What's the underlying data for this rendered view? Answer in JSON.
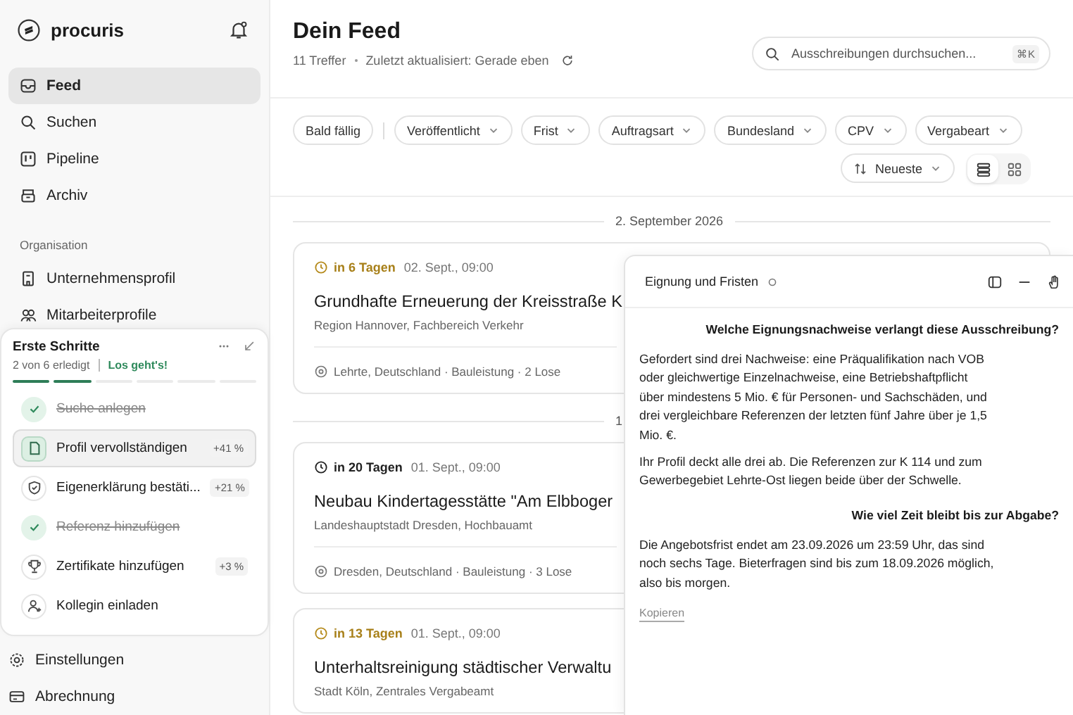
{
  "brand": {
    "name": "procuris"
  },
  "nav": [
    {
      "label": "Feed",
      "selected": true
    },
    {
      "label": "Suchen",
      "selected": false
    },
    {
      "label": "Pipeline",
      "selected": false
    },
    {
      "label": "Archiv",
      "selected": false
    }
  ],
  "org_section": {
    "title": "Organisation",
    "items": [
      {
        "label": "Unternehmensprofil",
        "selected": false
      },
      {
        "label": "Mitarbeiterprofile",
        "selected": false
      }
    ]
  },
  "onboarding": {
    "title": "Erste Schritte",
    "progress": "2 von 6 erledigt",
    "cta": "Los geht's!",
    "level": 0.333,
    "items": [
      {
        "label": "Suche anlegen",
        "done": true,
        "selected": false
      },
      {
        "label": "Profil vervollständigen",
        "gain": "+41 %",
        "done": false,
        "selected": true
      },
      {
        "label": "Eigenerklärung bestäti...",
        "gain": "+21 %",
        "done": false,
        "selected": false
      },
      {
        "label": "Referenz hinzufügen",
        "done": true,
        "selected": false
      },
      {
        "label": "Zertifikate hinzufügen",
        "gain": "+3 %",
        "done": false,
        "selected": false
      },
      {
        "label": "Kollegin einladen",
        "done": false,
        "selected": false
      }
    ]
  },
  "footer_nav": [
    {
      "label": "Einstellungen"
    },
    {
      "label": "Abrechnung"
    }
  ],
  "header": {
    "title": "Dein Feed",
    "count": "11 Treffer",
    "updated": "Zuletzt aktualisiert: Gerade eben"
  },
  "search": {
    "placeholder": "Ausschreibungen durchsuchen...",
    "shortcut": "⌘K"
  },
  "filters": [
    {
      "label": "Bald fällig",
      "kind": "toggle"
    },
    {
      "label": "Veröffentlicht",
      "kind": "dropdown"
    },
    {
      "label": "Frist",
      "kind": "dropdown"
    },
    {
      "label": "Auftragsart",
      "kind": "dropdown"
    },
    {
      "label": "Bundesland",
      "kind": "dropdown"
    },
    {
      "label": "CPV",
      "kind": "dropdown"
    },
    {
      "label": "Vergabeart",
      "kind": "dropdown"
    }
  ],
  "sort": {
    "label": "Neueste"
  },
  "views": [
    {
      "kind": "list",
      "selected": true
    },
    {
      "kind": "grid",
      "selected": false
    }
  ],
  "feed": [
    {
      "date": "2. September 2026",
      "cards": [
        {
          "deadline": "in 6 Tagen",
          "urgent": true,
          "time": "02. Sept., 09:00",
          "title": "Grundhafte Erneuerung der Kreisstraße K",
          "org": "Region Hannover, Fachbereich Verkehr",
          "meta": "Lehrte, Deutschland · Bauleistung · 2 Lose"
        }
      ]
    },
    {
      "date": "1",
      "cards": [
        {
          "deadline": "in 20 Tagen",
          "urgent": false,
          "time": "01. Sept., 09:00",
          "title": "Neubau Kindertagesstätte \"Am Elbboger",
          "org": "Landeshauptstadt Dresden, Hochbauamt",
          "meta": "Dresden, Deutschland · Bauleistung · 3 Lose"
        },
        {
          "deadline": "in 13 Tagen",
          "urgent": true,
          "time": "01. Sept., 09:00",
          "title": "Unterhaltsreinigung städtischer Verwaltu",
          "org": "Stadt Köln, Zentrales Vergabeamt"
        }
      ]
    }
  ],
  "chat": {
    "title": "Eignung und Fristen",
    "messages": [
      {
        "kind": "question",
        "text": "Welche Eignungsnachweise verlangt diese Ausschreibung?"
      },
      {
        "kind": "answer",
        "paragraphs": [
          "Gefordert sind drei Nachweise: eine Präqualifikation nach VOB oder gleichwertige Einzelnachweise, eine Betriebshaftpflicht über mindestens 5 Mio. € für Personen- und Sachschäden, und drei vergleichbare Referenzen der letzten fünf Jahre über je 1,5 Mio. €.",
          "Ihr Profil deckt alle drei ab. Die Referenzen zur K 114 und zum Gewerbegebiet Lehrte-Ost liegen beide über der Schwelle."
        ]
      },
      {
        "kind": "question",
        "text": "Wie viel Zeit bleibt bis zur Abgabe?"
      },
      {
        "kind": "answer",
        "paragraphs": [
          "Die Angebotsfrist endet am 23.09.2026 um 23:59 Uhr, das sind noch sechs Tage. Bieterfragen sind bis zum 18.09.2026 möglich, also bis morgen."
        ]
      }
    ],
    "copy": "Kopieren"
  }
}
